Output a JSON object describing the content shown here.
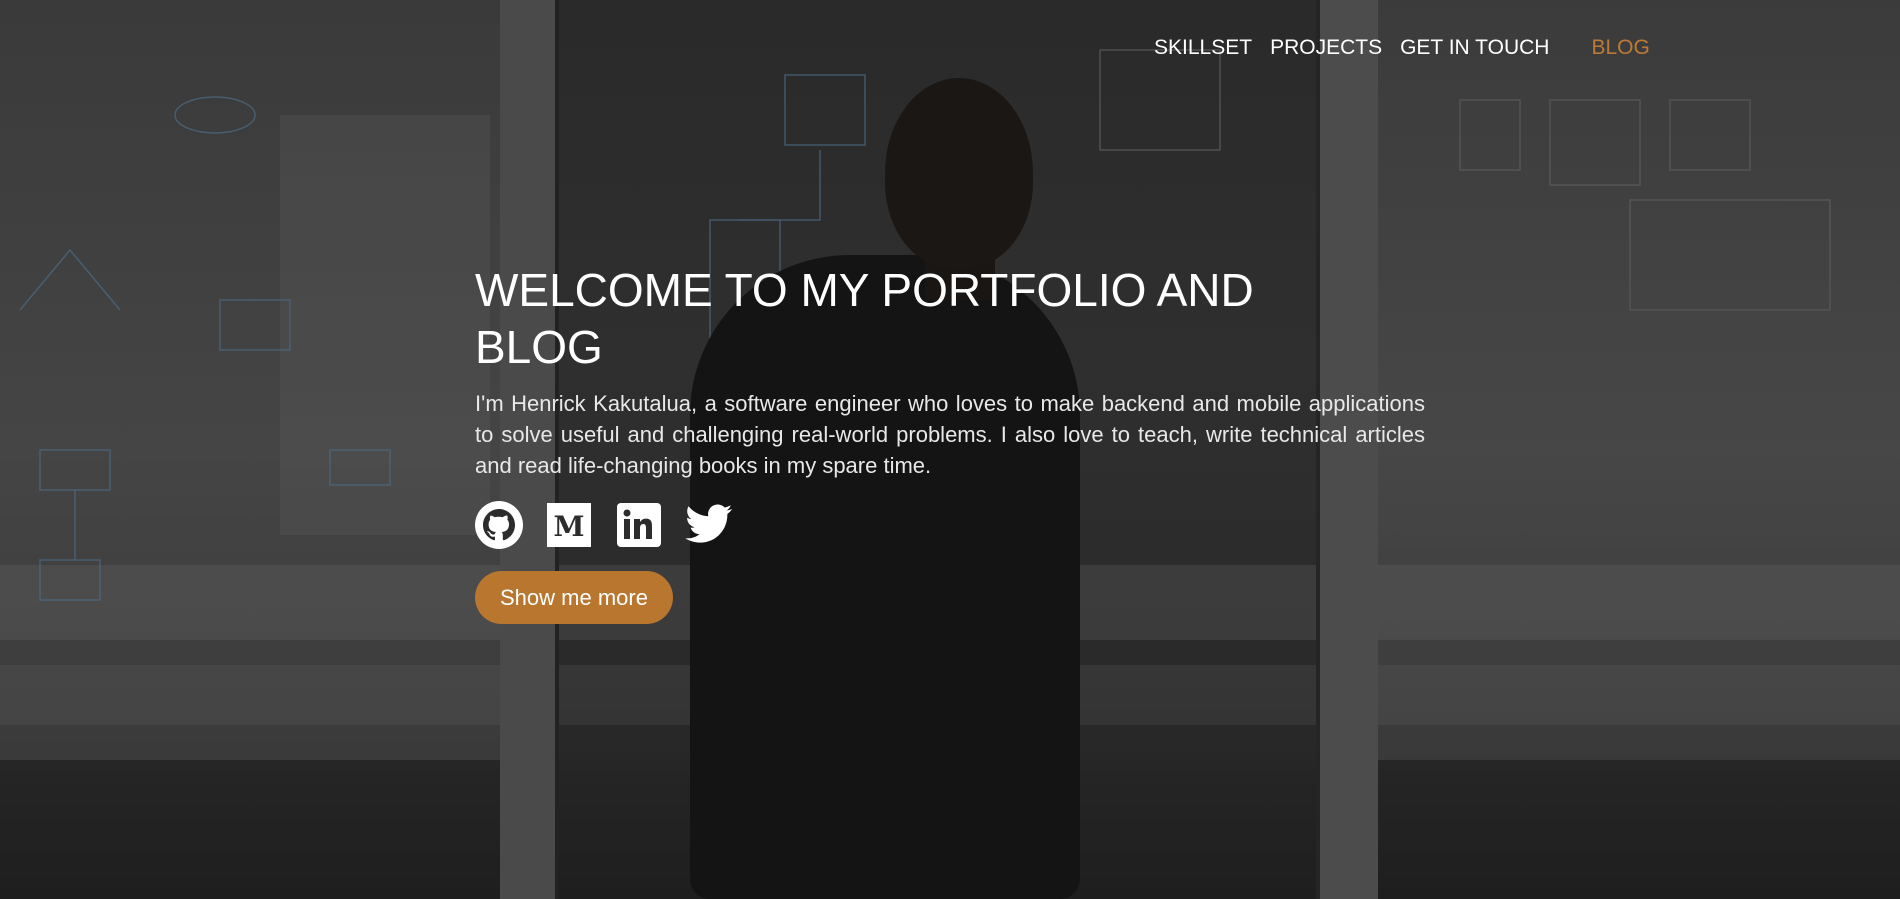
{
  "nav": {
    "items": [
      {
        "label": "SKILLSET"
      },
      {
        "label": "PROJECTS"
      },
      {
        "label": "GET IN TOUCH"
      },
      {
        "label": "BLOG"
      }
    ],
    "active_color": "#bd7a36"
  },
  "hero": {
    "title": "WELCOME TO MY PORTFOLIO AND BLOG",
    "intro": "I'm Henrick Kakutalua, a software engineer who loves to make backend and mobile applications to solve useful and challenging real-world problems. I also love to teach, write technical articles and read life-changing books in my spare time.",
    "cta_label": "Show me more",
    "cta_color": "#b8762f",
    "socials": [
      {
        "icon": "github-icon"
      },
      {
        "icon": "medium-icon"
      },
      {
        "icon": "linkedin-icon"
      },
      {
        "icon": "twitter-icon"
      }
    ]
  }
}
